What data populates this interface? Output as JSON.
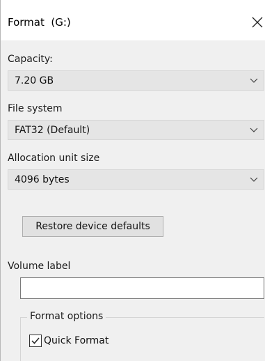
{
  "window": {
    "title": "Format  (G:)"
  },
  "capacity": {
    "label": "Capacity:",
    "selected": "7.20 GB"
  },
  "file_system": {
    "label": "File system",
    "selected": "FAT32 (Default)"
  },
  "allocation_unit_size": {
    "label": "Allocation unit size",
    "selected": "4096 bytes"
  },
  "restore_button": {
    "label": "Restore device defaults"
  },
  "volume_label": {
    "label": "Volume label",
    "value": ""
  },
  "format_options": {
    "legend": "Format options",
    "quick_format": {
      "label": "Quick Format",
      "checked": true
    }
  },
  "icons": {
    "close": "close-icon",
    "dropdown": "chevron-down-icon",
    "check": "checkmark-icon"
  }
}
